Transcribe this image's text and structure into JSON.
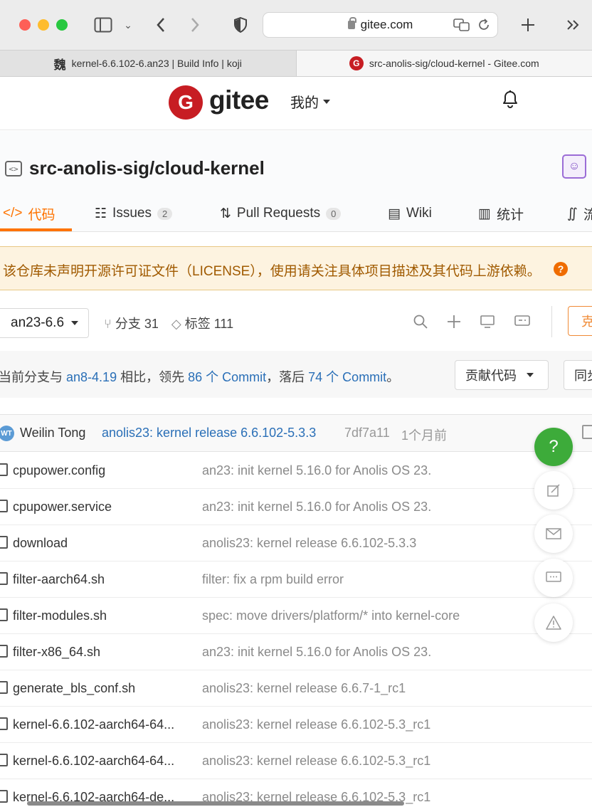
{
  "browser": {
    "url": "gitee.com",
    "tabs": [
      {
        "favicon": "魏",
        "label": "kernel-6.6.102-6.an23 | Build Info | koji"
      },
      {
        "favicon": "G",
        "label": "src-anolis-sig/cloud-kernel - Gitee.com"
      }
    ]
  },
  "header": {
    "logo_mark": "G",
    "logo_text": "gitee",
    "mine_label": "我的"
  },
  "repo": {
    "icon_text": "<>",
    "title": "src-anolis-sig/cloud-kernel",
    "tabs": [
      {
        "icon": "</>",
        "label": "代码"
      },
      {
        "icon": "☷",
        "label": "Issues",
        "count": "2"
      },
      {
        "icon": "⇅",
        "label": "Pull Requests",
        "count": "0"
      },
      {
        "icon": "▤",
        "label": "Wiki"
      },
      {
        "icon": "▥",
        "label": "统计"
      },
      {
        "icon": "∬",
        "label": "流"
      }
    ]
  },
  "warning": {
    "text": "该仓库未声明开源许可证文件（LICENSE），使用请关注具体项目描述及其代码上游依赖。",
    "help": "?"
  },
  "branch": {
    "name": "an23-6.6",
    "branches_label": "分支 31",
    "tags_label": "标签 111",
    "clone_label": "克"
  },
  "compare": {
    "prefix": "当前分支与",
    "base": "an8-4.19",
    "middle1": "相比，领先",
    "ahead": "86 个 Commit",
    "middle2": "，落后",
    "behind": "74 个 Commit",
    "suffix": "。",
    "contribute_label": "贡献代码",
    "sync_label": "同步"
  },
  "latest_commit": {
    "avatar": "WT",
    "author": "Weilin Tong",
    "message": "anolis23: kernel release 6.6.102-5.3.3",
    "hash": "7df7a11",
    "time": "1个月前"
  },
  "files": [
    {
      "name": "cpupower.config",
      "commit": "an23: init kernel 5.16.0 for Anolis OS 23."
    },
    {
      "name": "cpupower.service",
      "commit": "an23: init kernel 5.16.0 for Anolis OS 23."
    },
    {
      "name": "download",
      "commit": "anolis23: kernel release 6.6.102-5.3.3"
    },
    {
      "name": "filter-aarch64.sh",
      "commit": "filter: fix a rpm build error"
    },
    {
      "name": "filter-modules.sh",
      "commit": "spec: move drivers/platform/* into kernel-core"
    },
    {
      "name": "filter-x86_64.sh",
      "commit": "an23: init kernel 5.16.0 for Anolis OS 23."
    },
    {
      "name": "generate_bls_conf.sh",
      "commit": "anolis23: kernel release 6.6.7-1_rc1"
    },
    {
      "name": "kernel-6.6.102-aarch64-64...",
      "commit": "anolis23: kernel release 6.6.102-5.3_rc1"
    },
    {
      "name": "kernel-6.6.102-aarch64-64...",
      "commit": "anolis23: kernel release 6.6.102-5.3_rc1"
    },
    {
      "name": "kernel-6.6.102-aarch64-de...",
      "commit": "anolis23: kernel release 6.6.102-5.3_rc1"
    }
  ],
  "floating": {
    "help": "?"
  }
}
